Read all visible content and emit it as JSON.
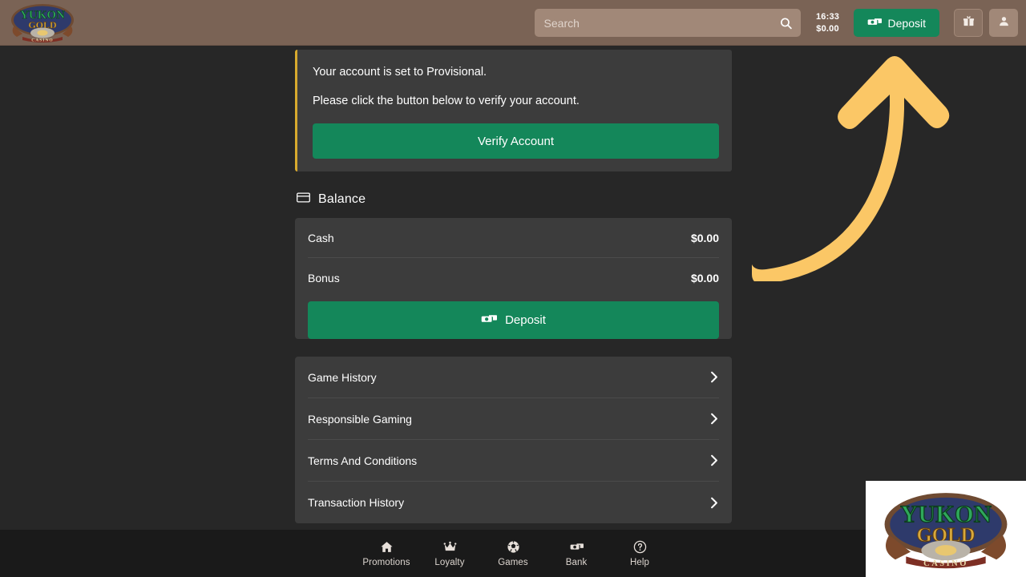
{
  "header": {
    "logo_alt": "Yukon Gold Casino",
    "search": {
      "placeholder": "Search",
      "value": ""
    },
    "time": "16:33",
    "balance": "$0.00",
    "deposit_label": "Deposit",
    "gift_icon": "gift-icon",
    "profile_icon": "user-icon"
  },
  "notice": {
    "line1": "Your account is set to Provisional.",
    "line2": "Please click the button below to verify your account.",
    "button_label": "Verify Account",
    "accent_color": "#d8aa2e"
  },
  "balance": {
    "section_label": "Balance",
    "section_icon": "credit-card-icon",
    "rows": [
      {
        "label": "Cash",
        "value": "$0.00"
      },
      {
        "label": "Bonus",
        "value": "$0.00"
      }
    ],
    "deposit_label": "Deposit",
    "deposit_icon": "cash-icon"
  },
  "menu": {
    "items": [
      {
        "label": "Game History"
      },
      {
        "label": "Responsible Gaming"
      },
      {
        "label": "Terms And Conditions"
      },
      {
        "label": "Transaction History"
      }
    ]
  },
  "bottom_nav": {
    "items": [
      {
        "label": "Promotions",
        "icon": "home-icon"
      },
      {
        "label": "Loyalty",
        "icon": "crown-icon"
      },
      {
        "label": "Games",
        "icon": "soccer-ball-icon"
      },
      {
        "label": "Bank",
        "icon": "cash-icon"
      },
      {
        "label": "Help",
        "icon": "question-circle-icon"
      }
    ]
  },
  "annotation": {
    "arrow_color": "#fbc766",
    "arrow_direction": "curved-up-right"
  },
  "watermark": {
    "brand": "Yukon Gold Casino",
    "word_top": "YUKON",
    "word_mid": "GOLD",
    "word_bottom": "CASINO"
  },
  "theme": {
    "page_bg": "#272727",
    "header_bg": "#7a6355",
    "card_bg": "#3c3c3c",
    "accent_green": "#14875a",
    "bottom_nav_bg": "#1a1a1a"
  }
}
